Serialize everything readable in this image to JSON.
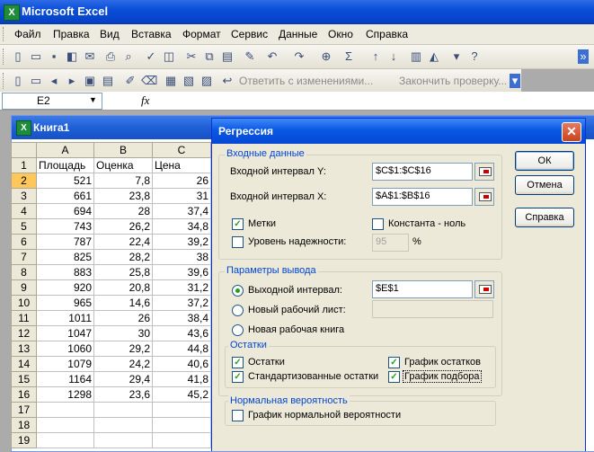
{
  "app": {
    "title": "Microsoft Excel"
  },
  "menu": [
    "Файл",
    "Правка",
    "Вид",
    "Вставка",
    "Формат",
    "Сервис",
    "Данные",
    "Окно",
    "Справка"
  ],
  "review_toolbar": {
    "reply_label": "Ответить с изменениями...",
    "end_review_label": "Закончить проверку..."
  },
  "formula_bar": {
    "name_box": "E2",
    "fx": "fx"
  },
  "workbook": {
    "title": "Книга1",
    "columns": [
      "A",
      "B",
      "C"
    ],
    "rows": [
      [
        "1",
        "Площадь",
        "Оценка",
        "Цена"
      ],
      [
        "2",
        "521",
        "7,8",
        "26"
      ],
      [
        "3",
        "661",
        "23,8",
        "31"
      ],
      [
        "4",
        "694",
        "28",
        "37,4"
      ],
      [
        "5",
        "743",
        "26,2",
        "34,8"
      ],
      [
        "6",
        "787",
        "22,4",
        "39,2"
      ],
      [
        "7",
        "825",
        "28,2",
        "38"
      ],
      [
        "8",
        "883",
        "25,8",
        "39,6"
      ],
      [
        "9",
        "920",
        "20,8",
        "31,2"
      ],
      [
        "10",
        "965",
        "14,6",
        "37,2"
      ],
      [
        "11",
        "1011",
        "26",
        "38,4"
      ],
      [
        "12",
        "1047",
        "30",
        "43,6"
      ],
      [
        "13",
        "1060",
        "29,2",
        "44,8"
      ],
      [
        "14",
        "1079",
        "24,2",
        "40,6"
      ],
      [
        "15",
        "1164",
        "29,4",
        "41,8"
      ],
      [
        "16",
        "1298",
        "23,6",
        "45,2"
      ],
      [
        "17",
        "",
        "",
        ""
      ],
      [
        "18",
        "",
        "",
        ""
      ],
      [
        "19",
        "",
        "",
        ""
      ]
    ]
  },
  "dialog": {
    "title": "Регрессия",
    "input_group": "Входные данные",
    "input_y_label": "Входной интервал Y:",
    "input_y_value": "$C$1:$C$16",
    "input_x_label": "Входной интервал X:",
    "input_x_value": "$A$1:$B$16",
    "labels_label": "Метки",
    "labels_checked": true,
    "const_zero_label": "Константа - ноль",
    "const_zero_checked": false,
    "confidence_label": "Уровень надежности:",
    "confidence_checked": false,
    "confidence_value": "95",
    "percent": "%",
    "output_group": "Параметры вывода",
    "output_range_label": "Выходной интервал:",
    "output_range_value": "$E$1",
    "new_sheet_label": "Новый рабочий лист:",
    "new_book_label": "Новая рабочая книга",
    "residuals_group": "Остатки",
    "residuals_label": "Остатки",
    "std_residuals_label": "Стандартизованные остатки",
    "residual_plot_label": "График остатков",
    "fit_plot_label": "График подбора",
    "normal_group": "Нормальная вероятность",
    "normal_plot_label": "График нормальной вероятности",
    "ok_label": "ОК",
    "cancel_label": "Отмена",
    "help_label": "Справка"
  }
}
